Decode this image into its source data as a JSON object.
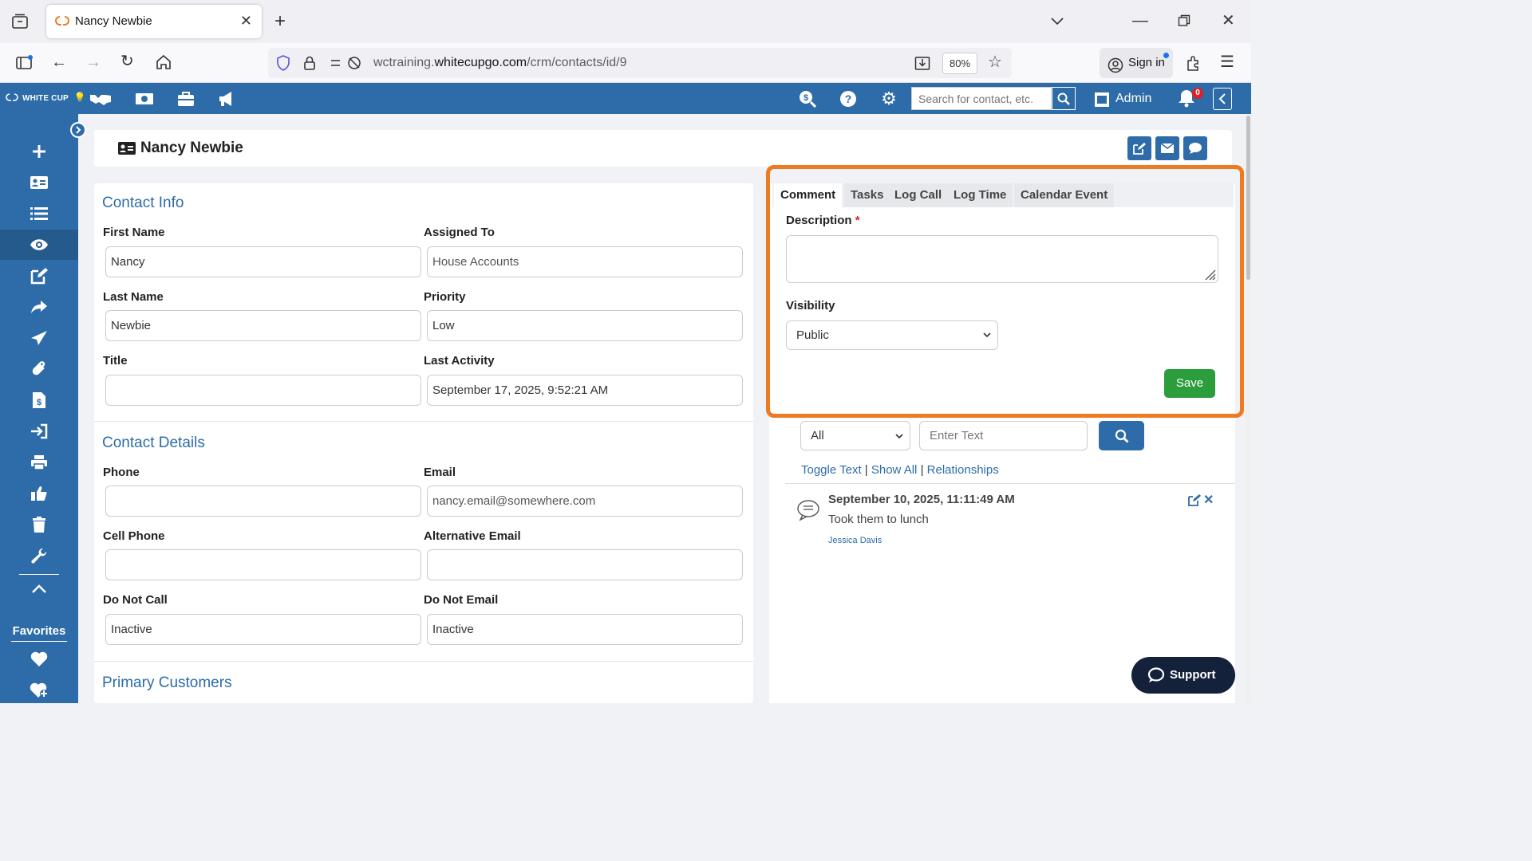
{
  "browser": {
    "tab_title": "Nancy Newbie",
    "url_prefix": "wctraining.",
    "url_domain": "whitecupgo.com",
    "url_path": "/crm/contacts/id/9",
    "zoom": "80%",
    "sign_in": "Sign in"
  },
  "appbar": {
    "logo": "WHITE CUP",
    "search_placeholder": "Search for contact, etc.",
    "admin_label": "Admin",
    "notification_count": "0"
  },
  "sidebar": {
    "favorites_label": "Favorites"
  },
  "header": {
    "contact_name": "Nancy Newbie"
  },
  "contact_info": {
    "title": "Contact Info",
    "fields": {
      "first_name_label": "First Name",
      "first_name": "Nancy",
      "assigned_to_label": "Assigned To",
      "assigned_to": "House Accounts",
      "last_name_label": "Last Name",
      "last_name": "Newbie",
      "priority_label": "Priority",
      "priority": "Low",
      "title_label": "Title",
      "title_value": "",
      "last_activity_label": "Last Activity",
      "last_activity": "September 17, 2025, 9:52:21 AM"
    }
  },
  "contact_details": {
    "title": "Contact Details",
    "fields": {
      "phone_label": "Phone",
      "phone": "",
      "email_label": "Email",
      "email": "nancy.email@somewhere.com",
      "cell_label": "Cell Phone",
      "cell": "",
      "alt_email_label": "Alternative Email",
      "alt_email": "",
      "do_not_call_label": "Do Not Call",
      "do_not_call": "Inactive",
      "do_not_email_label": "Do Not Email",
      "do_not_email": "Inactive"
    }
  },
  "primary_customers": {
    "title": "Primary Customers"
  },
  "activity_panel": {
    "tabs": [
      "Comment",
      "Tasks",
      "Log Call",
      "Log Time",
      "Calendar Event"
    ],
    "description_label": "Description",
    "required_mark": "*",
    "visibility_label": "Visibility",
    "visibility_value": "Public",
    "save_label": "Save",
    "filter_value": "All",
    "filter_placeholder": "Enter Text",
    "link_toggle": "Toggle Text",
    "link_show_all": "Show All",
    "link_relationships": "Relationships",
    "separator": "|",
    "entry": {
      "date": "September 10, 2025, 11:11:49 AM",
      "text": "Took them to lunch",
      "user": "Jessica Davis"
    }
  },
  "support_label": "Support",
  "colors": {
    "brand": "#2d6ca8",
    "highlight": "#ee7a22",
    "save": "#2b9d3c"
  }
}
